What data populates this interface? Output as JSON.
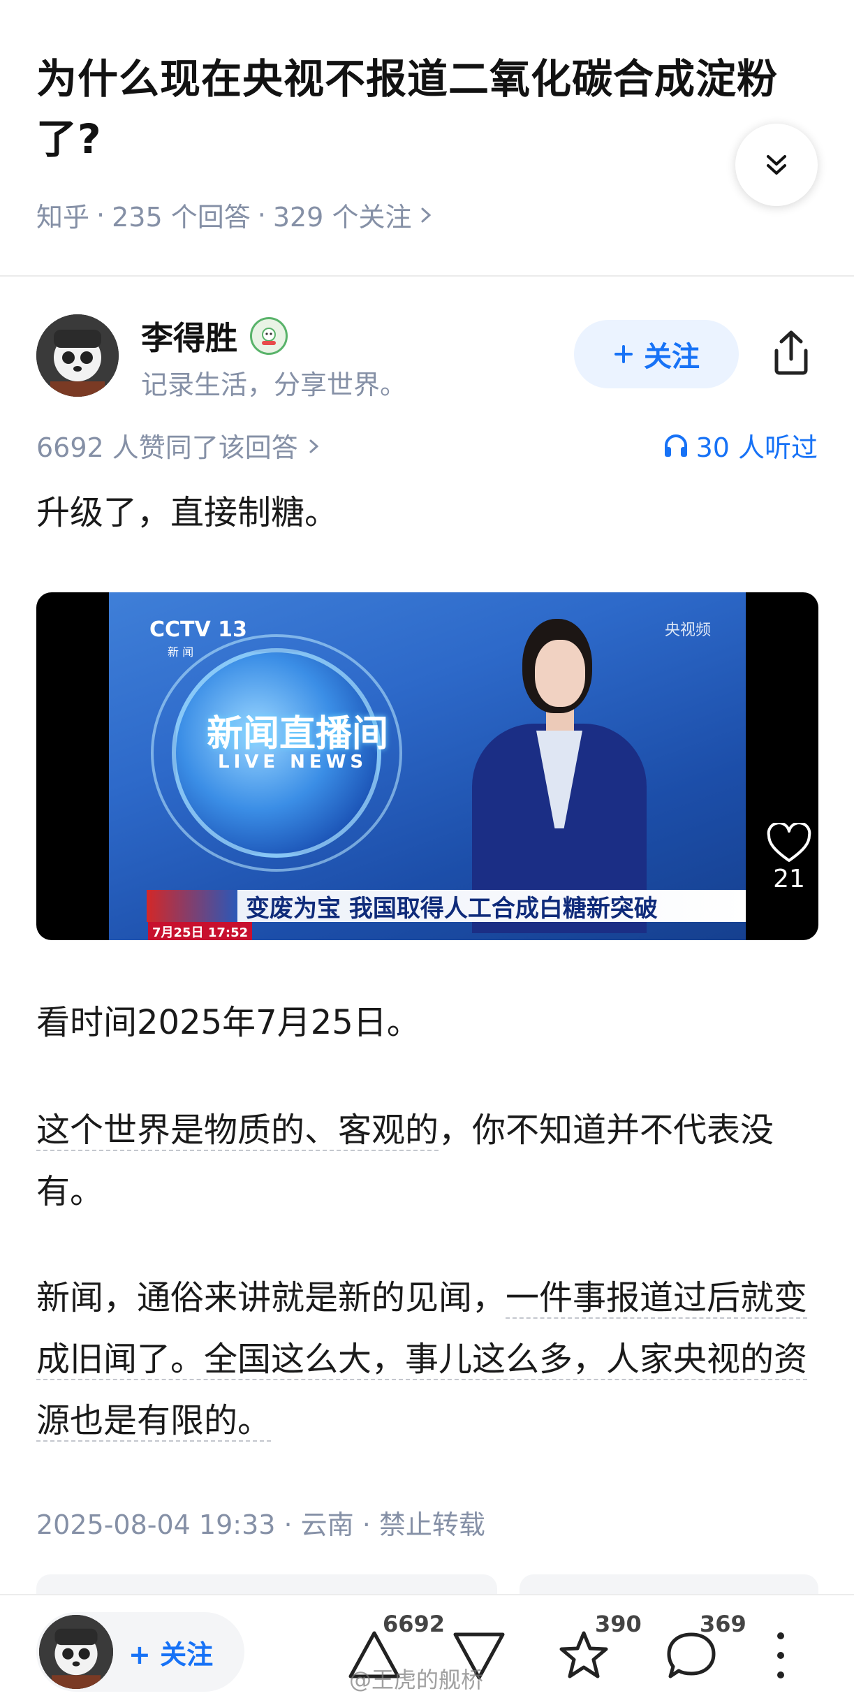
{
  "question": {
    "title": "为什么现在央视不报道二氧化碳合成淀粉了?",
    "source": "知乎",
    "answers": "235 个回答",
    "followers": "329 个关注",
    "meta_sep": "·"
  },
  "author": {
    "name": "李得胜",
    "bio": "记录生活，分享世界。",
    "follow_label": "关注"
  },
  "stats": {
    "upvote_text": "6692 人赞同了该回答",
    "listen_text": "30 人听过"
  },
  "answer": {
    "p1": "升级了，直接制糖。",
    "p2": "看时间2025年7月25日。",
    "p3a": "这个世界是物质的、客观的",
    "p3b": "，你不知道并不代表没有。",
    "p4a": "新闻，通俗来讲就是新的见闻，",
    "p4b": "一件事报道过后就变成旧闻了。全国这么大，事儿这么多，人家央视的资源也是有限的。"
  },
  "video": {
    "channel": "CCTV 13",
    "channel_sub": "新 闻",
    "watermark": "央视频",
    "show_title": "新闻直播间",
    "show_sub": "LIVE NEWS",
    "headline": "变废为宝 我国取得人工合成白糖新突破",
    "time": "7月25日 17:52",
    "likes": "21"
  },
  "footer": {
    "meta": "2025-08-04 19:33 · 云南 · 禁止转载"
  },
  "bottom_bar": {
    "follow_label": "关注",
    "upvotes": "6692",
    "favorites": "390",
    "comments": "369",
    "credit": "@王虎的舰桥"
  },
  "colors": {
    "accent": "#1772f6",
    "muted": "#8590a6"
  }
}
